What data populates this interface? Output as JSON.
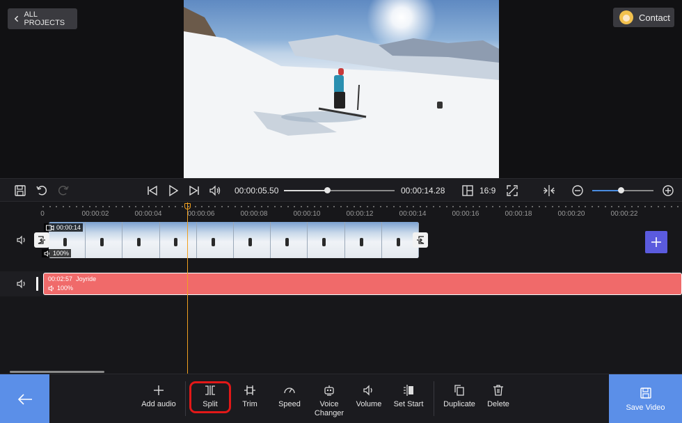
{
  "app": {
    "back_label": "ALL PROJECTS",
    "contact_label": "Contact"
  },
  "player": {
    "current_time": "00:00:05.50",
    "total_time": "00:00:14.28",
    "progress_fraction": 0.39,
    "aspect_ratio": "16:9",
    "zoom_fraction": 0.47
  },
  "ruler": {
    "labels": [
      "0",
      "00:00:02",
      "00:00:04",
      "00:00:06",
      "00:00:08",
      "00:00:10",
      "00:00:12",
      "00:00:14",
      "00:00:16",
      "00:00:18",
      "00:00:20",
      "00:00:22"
    ]
  },
  "video_clip": {
    "duration": "00:00:14",
    "volume": "100%"
  },
  "audio_clip": {
    "duration": "00:02:57",
    "name": "Joyride",
    "volume": "100%"
  },
  "toolbar": {
    "add_audio": "Add audio",
    "split": "Split",
    "trim": "Trim",
    "speed": "Speed",
    "voice_changer_1": "Voice",
    "voice_changer_2": "Changer",
    "volume": "Volume",
    "set_start": "Set Start",
    "duplicate": "Duplicate",
    "delete": "Delete",
    "save_video": "Save Video"
  },
  "colors": {
    "accent": "#5b8fe8",
    "audio_track": "#f06a6a",
    "playhead": "#f0a020",
    "highlight": "#e21818",
    "add_track": "#5b5bde"
  }
}
